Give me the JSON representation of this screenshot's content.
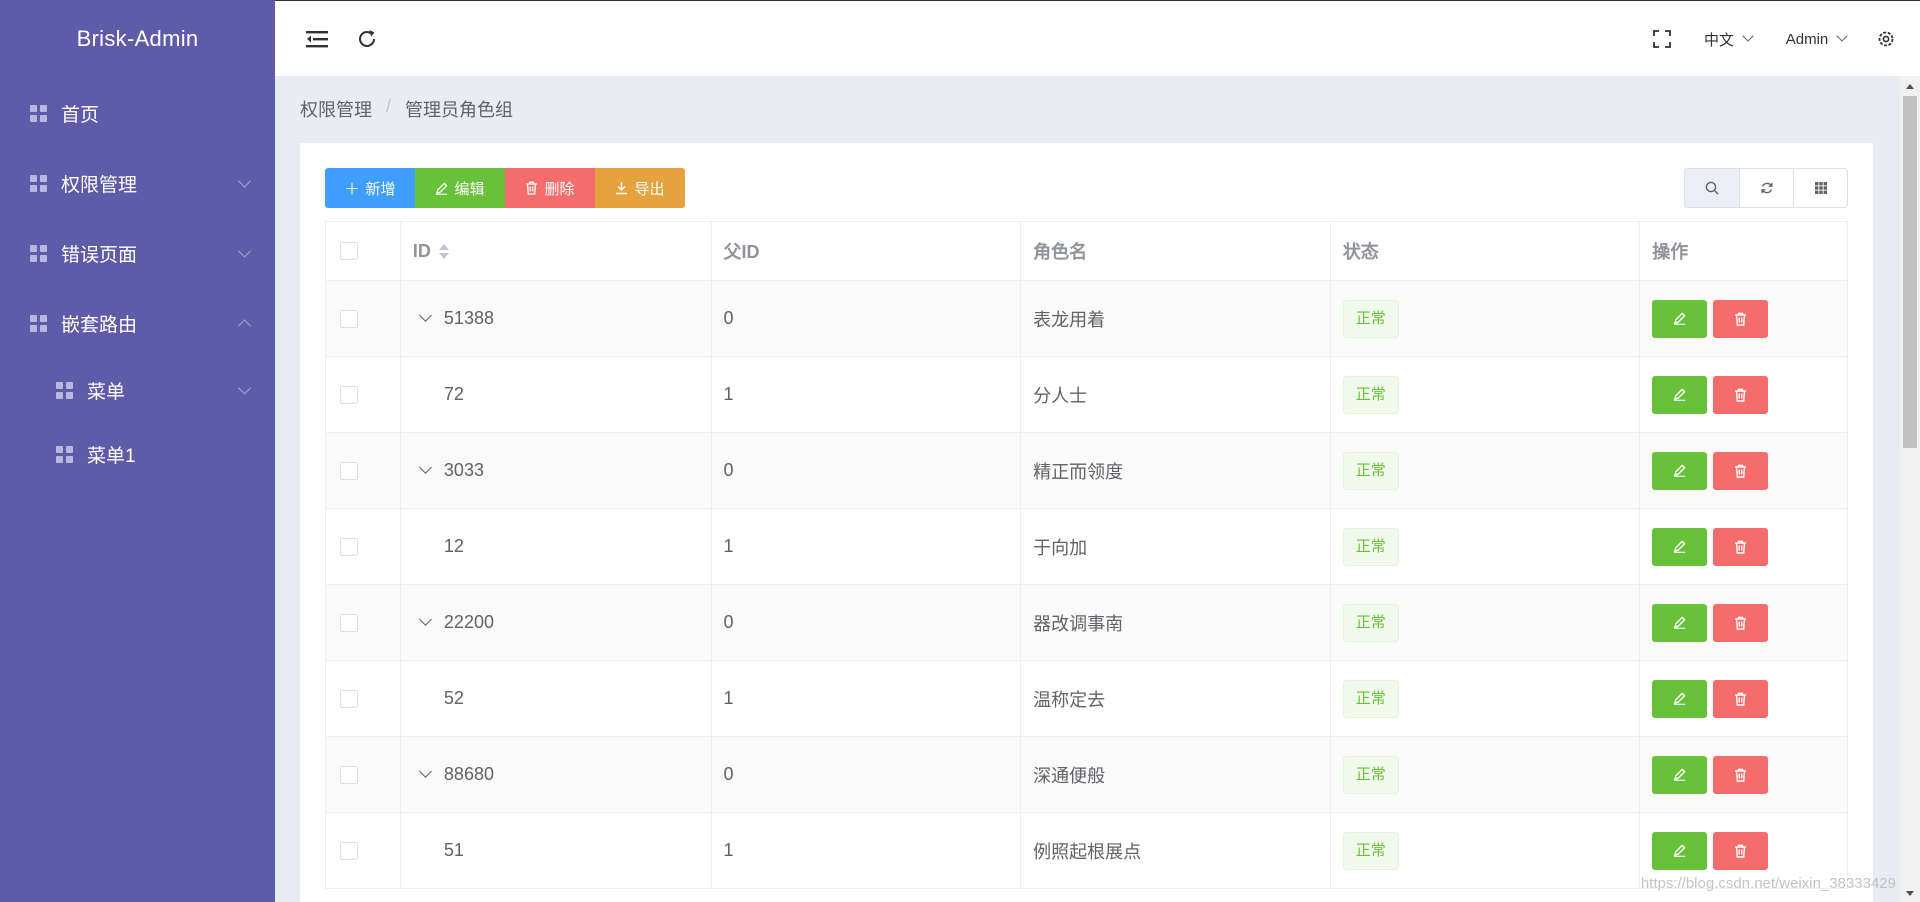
{
  "sidebar": {
    "brand": "Brisk-Admin",
    "items": [
      {
        "label": "首页"
      },
      {
        "label": "权限管理"
      },
      {
        "label": "错误页面"
      },
      {
        "label": "嵌套路由"
      },
      {
        "label": "菜单"
      },
      {
        "label": "菜单1"
      }
    ]
  },
  "header": {
    "language": "中文",
    "user": "Admin"
  },
  "breadcrumb": {
    "items": [
      "权限管理",
      "管理员角色组"
    ],
    "separator": "/"
  },
  "toolbar": {
    "add_label": "新增",
    "edit_label": "编辑",
    "delete_label": "删除",
    "export_label": "导出"
  },
  "table": {
    "headers": [
      "ID",
      "父ID",
      "角色名",
      "状态",
      "操作"
    ],
    "rows": [
      {
        "id": "51388",
        "pid": "0",
        "name": "表龙用着",
        "status": "正常"
      },
      {
        "id": "72",
        "pid": "1",
        "name": "分人士",
        "status": "正常"
      },
      {
        "id": "3033",
        "pid": "0",
        "name": "精正而领度",
        "status": "正常"
      },
      {
        "id": "12",
        "pid": "1",
        "name": "于向加",
        "status": "正常"
      },
      {
        "id": "22200",
        "pid": "0",
        "name": "器改调事南",
        "status": "正常"
      },
      {
        "id": "52",
        "pid": "1",
        "name": "温称定去",
        "status": "正常"
      },
      {
        "id": "88680",
        "pid": "0",
        "name": "深通便般",
        "status": "正常"
      },
      {
        "id": "51",
        "pid": "1",
        "name": "例照起根展点",
        "status": "正常"
      }
    ]
  },
  "watermark": "https://blog.csdn.net/weixin_38333429",
  "colors": {
    "sidebar": "#5e5ba8",
    "primary": "#409eff",
    "success": "#67c23a",
    "danger": "#f56c6c",
    "warning": "#e6a23c"
  }
}
